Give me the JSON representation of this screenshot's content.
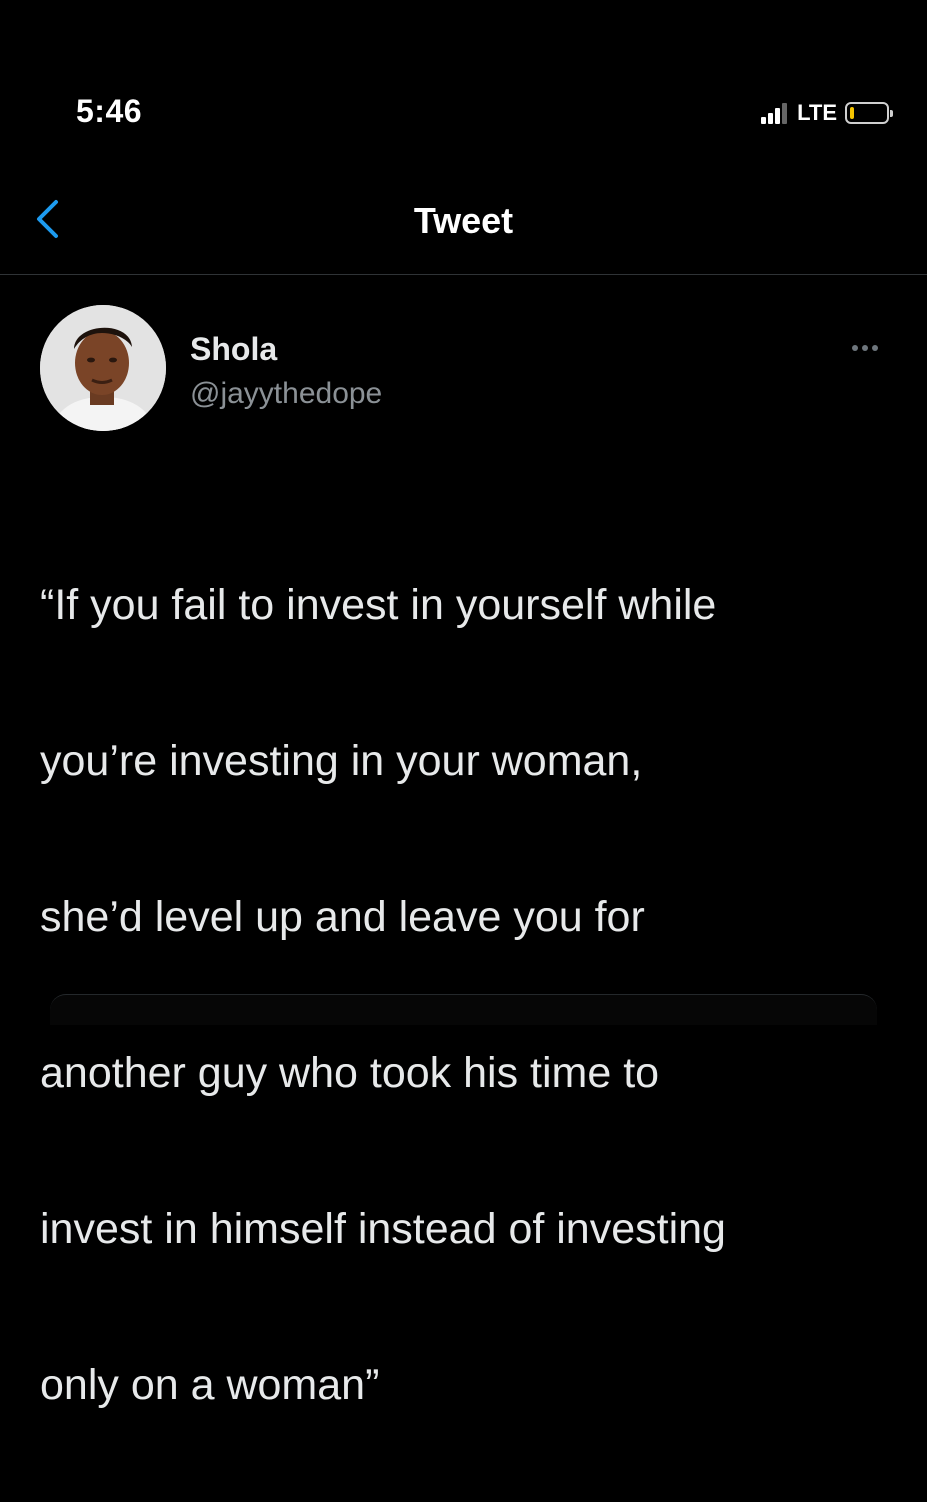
{
  "status_bar": {
    "time": "5:46",
    "network": "LTE",
    "battery_level": 0.12,
    "battery_color": "#f5c400",
    "signal_bars": 3
  },
  "header": {
    "back_icon": "chevron-left-icon",
    "title": "Tweet",
    "accent_color": "#1d9bf0"
  },
  "tweet": {
    "author": {
      "name": "Shola",
      "handle": "@jayythedope",
      "avatar_icon": "profile-photo"
    },
    "more_icon": "ellipsis-icon",
    "lines": [
      "“If you fail to invest in yourself while",
      "you’re investing in your woman,",
      "she’d level up and leave you for",
      "another guy who took his time to",
      "invest in himself instead of investing",
      "only on a woman”"
    ]
  }
}
